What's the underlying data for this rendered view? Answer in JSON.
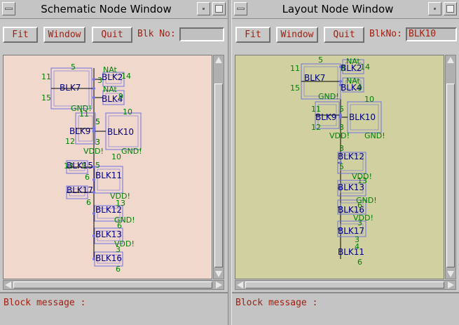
{
  "schematic": {
    "title": "Schematic Node Window",
    "buttons": {
      "fit": "Fit",
      "window": "Window",
      "quit": "Quit"
    },
    "blk_label": "Blk No:",
    "blk_value": "",
    "message_label": "Block message :",
    "canvas_bg": "#f0d8cc",
    "blocks": [
      {
        "name": "BLK7",
        "pins": [
          "5",
          "11",
          "15",
          "3",
          "GND!"
        ]
      },
      {
        "name": "BLK2",
        "pins": [
          "NAt",
          "14"
        ]
      },
      {
        "name": "BLK4",
        "pins": [
          "NAt",
          "9"
        ]
      },
      {
        "name": "BLK9",
        "pins": [
          "11",
          "12",
          "5",
          "3",
          "VDD!"
        ]
      },
      {
        "name": "BLK10",
        "pins": [
          "10",
          "5",
          "3",
          "GND!"
        ]
      },
      {
        "name": "BLK15",
        "pins": [
          "13",
          "5",
          "6"
        ]
      },
      {
        "name": "BLK11",
        "pins": [
          "10",
          "5",
          "VDD!",
          "13"
        ]
      },
      {
        "name": "BLK17",
        "pins": [
          "6"
        ]
      },
      {
        "name": "BLK12",
        "pins": [
          "GND!",
          "6"
        ]
      },
      {
        "name": "BLK13",
        "pins": [
          "VDD!",
          "3"
        ]
      },
      {
        "name": "BLK16",
        "pins": [
          "6"
        ]
      }
    ]
  },
  "layout": {
    "title": "Layout Node Window",
    "buttons": {
      "fit": "Fit",
      "window": "Window",
      "quit": "Quit"
    },
    "blk_label": "BlkNo:",
    "blk_value": "BLK10",
    "message_label": "Block message :",
    "canvas_bg": "#d0d0a0",
    "blocks": [
      {
        "name": "BLK7",
        "pins": [
          "5",
          "11",
          "15",
          "3",
          "GND!"
        ]
      },
      {
        "name": "BLK2",
        "pins": [
          "NAt",
          "14"
        ]
      },
      {
        "name": "BLK4",
        "pins": [
          "NAt",
          "9"
        ]
      },
      {
        "name": "BLK9",
        "pins": [
          "11",
          "12",
          "5",
          "3",
          "VDD!"
        ]
      },
      {
        "name": "BLK10",
        "pins": [
          "10",
          "GND!"
        ]
      },
      {
        "name": "BLK11",
        "pins": [
          "3",
          "5",
          "VDD!",
          "13"
        ]
      },
      {
        "name": "BLK12",
        "pins": [
          "GND!",
          "6"
        ]
      },
      {
        "name": "BLK13",
        "pins": [
          "VDD!",
          "3"
        ]
      },
      {
        "name": "BLK16",
        "pins": [
          "3",
          "4"
        ]
      },
      {
        "name": "BLK17",
        "pins": [
          "6"
        ]
      }
    ]
  },
  "colors": {
    "label_text": "#a02010",
    "block_outline": "#7070e0",
    "block_name": "#000080",
    "pin_text": "#008000",
    "wire": "#000000"
  }
}
